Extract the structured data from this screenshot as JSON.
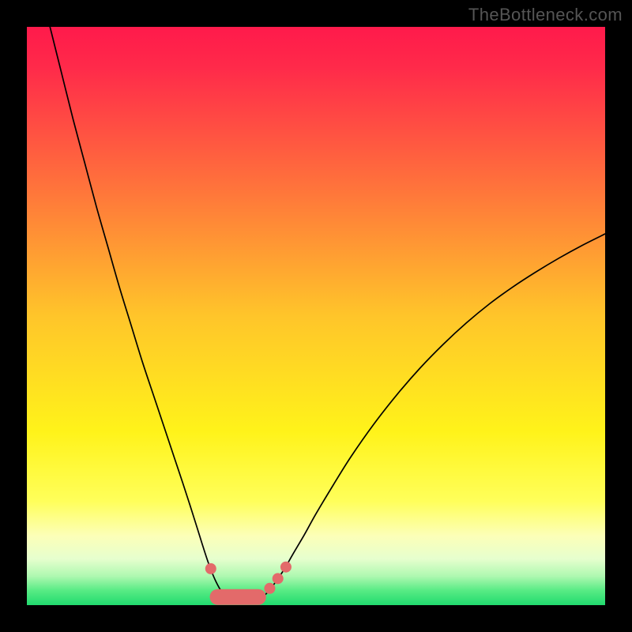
{
  "watermark": "TheBottleneck.com",
  "chart_data": {
    "type": "line",
    "title": "",
    "xlabel": "",
    "ylabel": "",
    "xlim": [
      0,
      100
    ],
    "ylim": [
      0,
      100
    ],
    "background_gradient": {
      "stops": [
        {
          "offset": 0.0,
          "color": "#ff1a4b"
        },
        {
          "offset": 0.07,
          "color": "#ff2a4a"
        },
        {
          "offset": 0.28,
          "color": "#ff743b"
        },
        {
          "offset": 0.5,
          "color": "#ffc52a"
        },
        {
          "offset": 0.7,
          "color": "#fff31a"
        },
        {
          "offset": 0.82,
          "color": "#ffff5a"
        },
        {
          "offset": 0.88,
          "color": "#fcffb8"
        },
        {
          "offset": 0.92,
          "color": "#e6ffce"
        },
        {
          "offset": 0.95,
          "color": "#aef8b0"
        },
        {
          "offset": 0.975,
          "color": "#57eb84"
        },
        {
          "offset": 1.0,
          "color": "#21da6e"
        }
      ]
    },
    "series": [
      {
        "name": "bottleneck-curve",
        "color": "#000000",
        "width": 1.7,
        "points": [
          {
            "x": 4.0,
            "y": 100.0
          },
          {
            "x": 6.0,
            "y": 92.0
          },
          {
            "x": 8.0,
            "y": 84.0
          },
          {
            "x": 10.0,
            "y": 76.5
          },
          {
            "x": 12.0,
            "y": 69.0
          },
          {
            "x": 14.0,
            "y": 62.0
          },
          {
            "x": 16.0,
            "y": 55.0
          },
          {
            "x": 18.0,
            "y": 48.5
          },
          {
            "x": 20.0,
            "y": 42.0
          },
          {
            "x": 22.0,
            "y": 36.0
          },
          {
            "x": 24.0,
            "y": 30.0
          },
          {
            "x": 25.5,
            "y": 25.5
          },
          {
            "x": 27.0,
            "y": 21.0
          },
          {
            "x": 28.3,
            "y": 17.0
          },
          {
            "x": 29.5,
            "y": 13.2
          },
          {
            "x": 30.5,
            "y": 10.0
          },
          {
            "x": 31.5,
            "y": 7.0
          },
          {
            "x": 32.5,
            "y": 4.5
          },
          {
            "x": 33.5,
            "y": 2.6
          },
          {
            "x": 34.5,
            "y": 1.3
          },
          {
            "x": 35.8,
            "y": 0.5
          },
          {
            "x": 37.5,
            "y": 0.2
          },
          {
            "x": 39.2,
            "y": 0.5
          },
          {
            "x": 40.5,
            "y": 1.2
          },
          {
            "x": 41.8,
            "y": 2.4
          },
          {
            "x": 43.0,
            "y": 4.0
          },
          {
            "x": 44.5,
            "y": 6.2
          },
          {
            "x": 46.0,
            "y": 8.8
          },
          {
            "x": 48.0,
            "y": 12.2
          },
          {
            "x": 50.0,
            "y": 15.8
          },
          {
            "x": 53.0,
            "y": 20.8
          },
          {
            "x": 56.0,
            "y": 25.6
          },
          {
            "x": 60.0,
            "y": 31.3
          },
          {
            "x": 64.0,
            "y": 36.4
          },
          {
            "x": 68.0,
            "y": 41.0
          },
          {
            "x": 72.0,
            "y": 45.1
          },
          {
            "x": 76.0,
            "y": 48.8
          },
          {
            "x": 80.0,
            "y": 52.1
          },
          {
            "x": 84.0,
            "y": 55.0
          },
          {
            "x": 88.0,
            "y": 57.6
          },
          {
            "x": 92.0,
            "y": 60.0
          },
          {
            "x": 96.0,
            "y": 62.2
          },
          {
            "x": 100.0,
            "y": 64.2
          }
        ]
      }
    ],
    "markers": {
      "name": "highlighted-points",
      "fill": "#e36a6a",
      "stroke": "#c94f4f",
      "r_small": 7,
      "points_small": [
        {
          "x": 31.8,
          "y": 6.3
        },
        {
          "x": 42.0,
          "y": 2.9
        },
        {
          "x": 43.4,
          "y": 4.6
        },
        {
          "x": 44.8,
          "y": 6.6
        }
      ],
      "capsule": {
        "x1": 33.0,
        "y1": 1.4,
        "x2": 40.0,
        "y2": 1.4,
        "r": 10
      }
    }
  }
}
